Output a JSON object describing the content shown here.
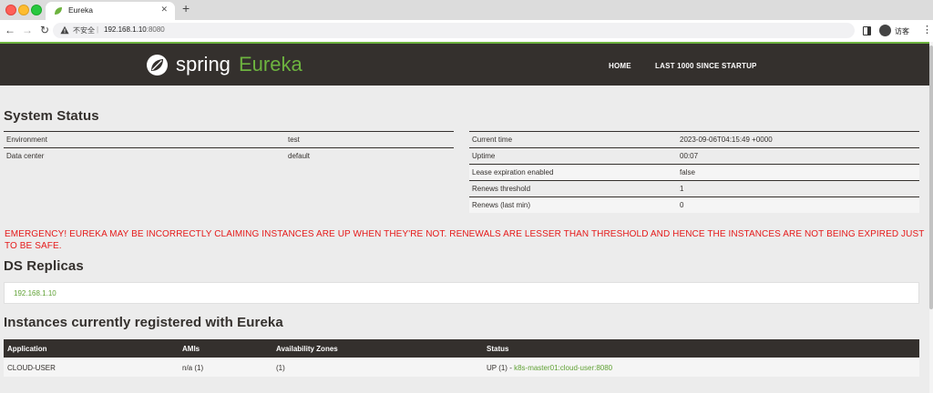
{
  "browser": {
    "tab_title": "Eureka",
    "tab_close": "✕",
    "new_tab": "+",
    "security_label": "不安全",
    "url_host": "192.168.1.10",
    "url_port": ":8080",
    "profile_label": "访客",
    "icons": [
      "back-arrow-icon",
      "forward-arrow-icon",
      "reload-icon",
      "warning-icon",
      "side-panel-icon",
      "avatar-icon",
      "kebab-menu-icon"
    ]
  },
  "header": {
    "logo_spring": "spring",
    "logo_eureka": "Eureka",
    "nav": [
      "HOME",
      "LAST 1000 SINCE STARTUP"
    ],
    "brand_color": "#6db33f",
    "bg_color": "#34302d"
  },
  "system_status": {
    "title": "System Status",
    "left": [
      {
        "key": "Environment",
        "value": "test"
      },
      {
        "key": "Data center",
        "value": "default"
      }
    ],
    "right": [
      {
        "key": "Current time",
        "value": "2023-09-06T04:15:49 +0000"
      },
      {
        "key": "Uptime",
        "value": "00:07"
      },
      {
        "key": "Lease expiration enabled",
        "value": "false"
      },
      {
        "key": "Renews threshold",
        "value": "1"
      },
      {
        "key": "Renews (last min)",
        "value": "0"
      }
    ]
  },
  "emergency_message": "EMERGENCY! EUREKA MAY BE INCORRECTLY CLAIMING INSTANCES ARE UP WHEN THEY'RE NOT. RENEWALS ARE LESSER THAN THRESHOLD AND HENCE THE INSTANCES ARE NOT BEING EXPIRED JUST TO BE SAFE.",
  "ds_replicas": {
    "title": "DS Replicas",
    "replicas": [
      "192.168.1.10"
    ]
  },
  "instances": {
    "title": "Instances currently registered with Eureka",
    "columns": [
      "Application",
      "AMIs",
      "Availability Zones",
      "Status"
    ],
    "rows": [
      {
        "application": "CLOUD-USER",
        "amis": "n/a (1)",
        "zones": "(1)",
        "status_prefix": "UP (1) - ",
        "status_link": "k8s-master01:cloud-user:8080"
      }
    ]
  }
}
